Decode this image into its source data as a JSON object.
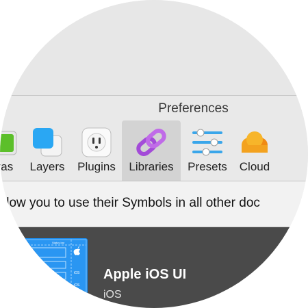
{
  "window": {
    "title": "Preferences"
  },
  "toolbar": {
    "tabs": [
      {
        "label": "vas",
        "icon": "canvas-icon",
        "selected": false
      },
      {
        "label": "Layers",
        "icon": "layers-icon",
        "selected": false
      },
      {
        "label": "Plugins",
        "icon": "plugins-icon",
        "selected": false
      },
      {
        "label": "Libraries",
        "icon": "libraries-icon",
        "selected": true
      },
      {
        "label": "Presets",
        "icon": "presets-icon",
        "selected": false
      },
      {
        "label": "Cloud",
        "icon": "cloud-icon",
        "selected": false
      }
    ]
  },
  "libraries": {
    "description": "llow you to use their Symbols in all other doc",
    "items": [
      {
        "name": "Apple iOS UI",
        "subtitle": "iOS",
        "thumbnail_labels": [
          "Status bar",
          "iOS",
          "Navigation bar",
          "iOS",
          "iOS"
        ]
      }
    ]
  },
  "colors": {
    "accent_selected_tab": "#d3d3d3",
    "list_background": "#4a4a4a",
    "thumbnail_blue": "#1e8ff0",
    "libraries_icon_purple": "#a34bd8",
    "cloud_orange": "#f79a1e"
  }
}
